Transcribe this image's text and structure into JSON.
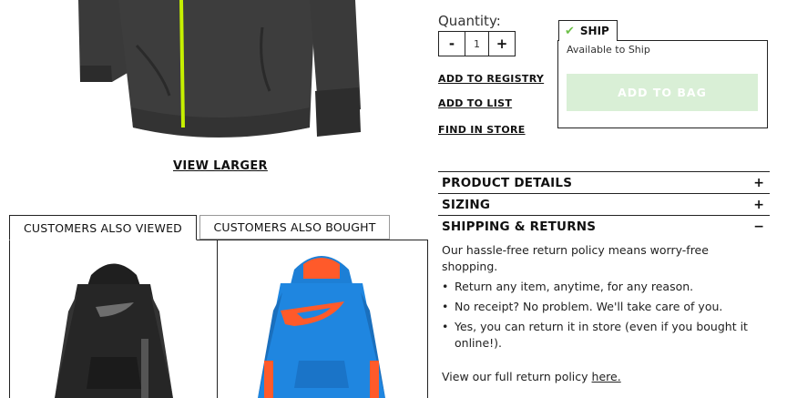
{
  "product": {
    "view_larger": "VIEW LARGER"
  },
  "quantity": {
    "label": "Quantity:",
    "minus": "-",
    "value": "1",
    "plus": "+"
  },
  "links": {
    "registry": "ADD TO REGISTRY",
    "list": "ADD TO LIST",
    "store": "FIND IN STORE"
  },
  "ship": {
    "check_icon": "check-icon",
    "tab_label": "SHIP",
    "availability": "Available to Ship",
    "add_to_bag": "ADD TO BAG"
  },
  "accordion": [
    {
      "title": "PRODUCT DETAILS",
      "sign": "+"
    },
    {
      "title": "SIZING",
      "sign": "+"
    },
    {
      "title": "SHIPPING & RETURNS",
      "sign": "−"
    }
  ],
  "returns": {
    "intro": "Our hassle-free return policy means worry-free shopping.",
    "bullets": [
      "Return any item, anytime, for any reason.",
      "No receipt? No problem. We'll take care of you.",
      "Yes, you can return it in store (even if you bought it online!)."
    ],
    "footer_text": "View our full return policy ",
    "footer_link": "here."
  },
  "customers": {
    "tab_viewed": "CUSTOMERS ALSO VIEWED",
    "tab_bought": "CUSTOMERS ALSO BOUGHT"
  },
  "colors": {
    "jacket": "#3a3a3a",
    "zipper": "#c6f000",
    "add_to_bag_bg": "#d9efd6",
    "check": "#6ec04a",
    "blue_hoodie": "#1d7fd6",
    "orange_accent": "#ff5a2a"
  }
}
